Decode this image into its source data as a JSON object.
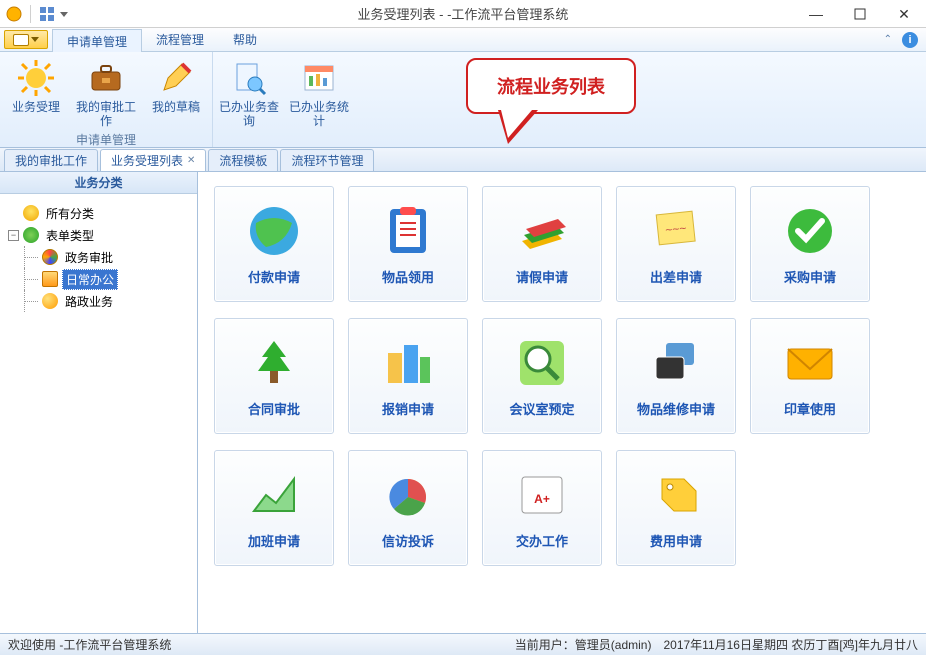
{
  "window": {
    "title": "业务受理列表 - -工作流平台管理系统"
  },
  "menutabs": {
    "items": [
      "申请单管理",
      "流程管理",
      "帮助"
    ],
    "active": 0
  },
  "ribbon": {
    "group_title": "申请单管理",
    "buttons": [
      {
        "label": "业务受理"
      },
      {
        "label": "我的审批工作"
      },
      {
        "label": "我的草稿"
      },
      {
        "label": "已办业务查询"
      },
      {
        "label": "已办业务统计"
      }
    ]
  },
  "callout": {
    "text": "流程业务列表"
  },
  "doctabs": {
    "items": [
      {
        "label": "我的审批工作",
        "active": false,
        "closable": false
      },
      {
        "label": "业务受理列表",
        "active": true,
        "closable": true
      },
      {
        "label": "流程模板",
        "active": false,
        "closable": false
      },
      {
        "label": "流程环节管理",
        "active": false,
        "closable": false
      }
    ]
  },
  "sidebar": {
    "header": "业务分类",
    "root": {
      "label": "所有分类"
    },
    "types": {
      "label": "表单类型",
      "children": [
        {
          "label": "政务审批",
          "icon": "palette"
        },
        {
          "label": "日常办公",
          "icon": "doc",
          "selected": true
        },
        {
          "label": "路政业务",
          "icon": "ball"
        }
      ]
    }
  },
  "cards": [
    {
      "label": "付款申请"
    },
    {
      "label": "物品领用"
    },
    {
      "label": "请假申请"
    },
    {
      "label": "出差申请"
    },
    {
      "label": "采购申请"
    },
    {
      "label": "合同审批"
    },
    {
      "label": "报销申请"
    },
    {
      "label": "会议室预定"
    },
    {
      "label": "物品维修申请"
    },
    {
      "label": "印章使用"
    },
    {
      "label": "加班申请"
    },
    {
      "label": "信访投诉"
    },
    {
      "label": "交办工作"
    },
    {
      "label": "费用申请"
    }
  ],
  "statusbar": {
    "welcome": "欢迎使用 -工作流平台管理系统",
    "user": "当前用户：管理员(admin)",
    "date": "2017年11月16日星期四 农历丁酉[鸡]年九月廿八"
  }
}
